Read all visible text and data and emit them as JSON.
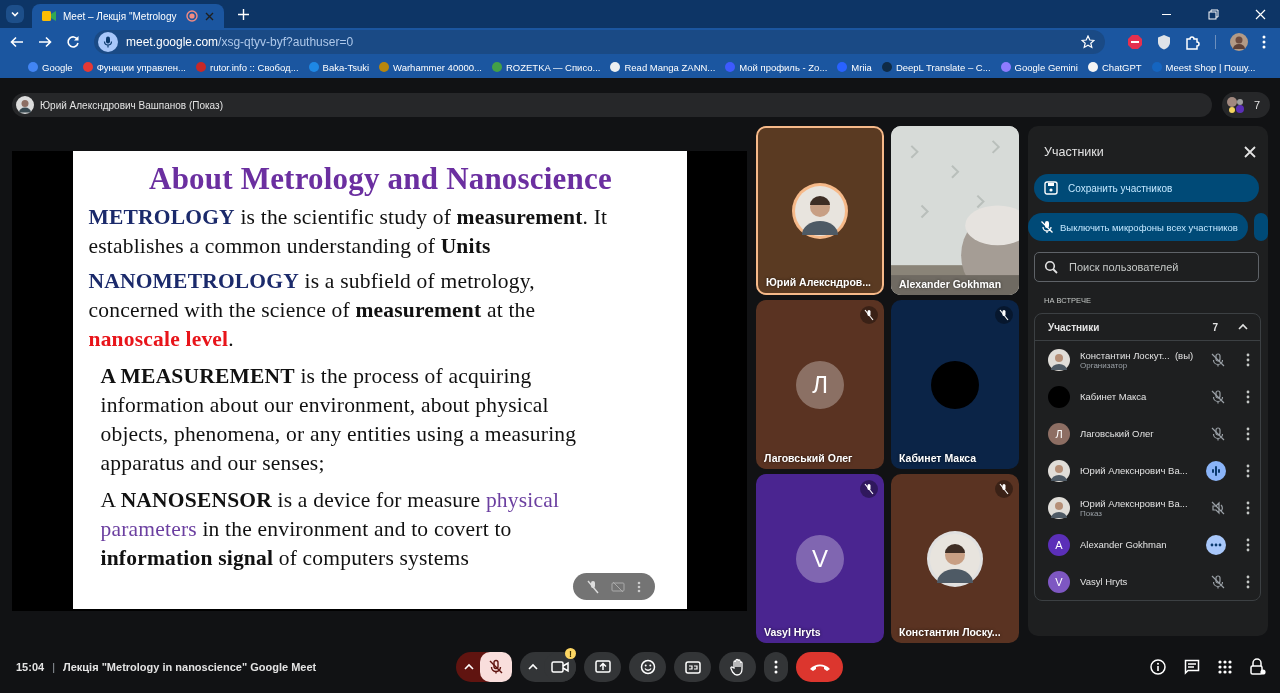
{
  "browser": {
    "tab": {
      "title": "Meet – Лекція \"Metrology",
      "recording": true
    },
    "url_host": "meet.google.com",
    "url_path": "/xsg-qtyv-byf?authuser=0",
    "bookmarks": [
      {
        "label": "Google",
        "color": "#4285f4"
      },
      {
        "label": "Функции управлен...",
        "color": "#e53935"
      },
      {
        "label": "rutor.info :: Свобод...",
        "color": "#c62828"
      },
      {
        "label": "Baka-Tsuki",
        "color": "#1e88e5"
      },
      {
        "label": "Warhammer 40000...",
        "color": "#b8860b"
      },
      {
        "label": "ROZETKA — Списо...",
        "color": "#43a047"
      },
      {
        "label": "Read Manga ZANN...",
        "color": "#eceff1"
      },
      {
        "label": "Мой профиль - Zo...",
        "color": "#3d5afe"
      },
      {
        "label": "Mriia",
        "color": "#2962ff"
      },
      {
        "label": "DeepL Translate – C...",
        "color": "#0f2b46"
      },
      {
        "label": "Google Gemini",
        "color": "#8e7cff"
      },
      {
        "label": "ChatGPT",
        "color": "#f5f5f5"
      },
      {
        "label": "Meest Shop | Пошу...",
        "color": "#1565c0"
      }
    ]
  },
  "presenter": {
    "label": "Юрий Алексндрович Вашпанов (Показ)",
    "count": "7"
  },
  "slide": {
    "title": "About Metrology and Nanoscience",
    "paragraphs": [
      {
        "lines": [
          [
            {
              "t": "METROLOGY",
              "kind": "term"
            },
            {
              "t": " is the scientific study of ",
              "kind": "plain"
            },
            {
              "t": "measurement",
              "kind": "bold"
            },
            {
              "t": ". It",
              "kind": "plain"
            }
          ],
          [
            {
              "t": "establishes a common understanding of ",
              "kind": "plain"
            },
            {
              "t": "Units",
              "kind": "bold"
            }
          ]
        ]
      },
      {
        "lines": [
          [
            {
              "t": "NANOMETROLOGY",
              "kind": "term"
            },
            {
              "t": " is a subfield of metrology,",
              "kind": "plain"
            }
          ],
          [
            {
              "t": "concerned with the science of ",
              "kind": "plain"
            },
            {
              "t": "measurement",
              "kind": "bold"
            },
            {
              "t": " at the",
              "kind": "plain"
            }
          ],
          [
            {
              "t": "nanoscale level",
              "kind": "alert"
            },
            {
              "t": ".",
              "kind": "plain"
            }
          ]
        ]
      },
      {
        "lines": [
          [
            {
              "t": "A MEASUREMENT",
              "kind": "bold"
            },
            {
              "t": " is the process of acquiring",
              "kind": "plain"
            }
          ],
          [
            {
              "t": "information about our environment, about physical",
              "kind": "plain"
            }
          ],
          [
            {
              "t": "objects, phenomena, or any entities using a measuring",
              "kind": "plain"
            }
          ],
          [
            {
              "t": "apparatus and our senses;",
              "kind": "plain"
            }
          ]
        ]
      },
      {
        "lines": [
          [
            {
              "t": "A ",
              "kind": "plain"
            },
            {
              "t": "NANOSENSOR",
              "kind": "bold"
            },
            {
              "t": " is a device for measure ",
              "kind": "plain"
            },
            {
              "t": "physical",
              "kind": "accent"
            }
          ],
          [
            {
              "t": "parameters",
              "kind": "accent"
            },
            {
              "t": " in the environment and to covert  to",
              "kind": "plain"
            }
          ],
          [
            {
              "t": "information signal",
              "kind": "bold"
            },
            {
              "t": " of computers systems",
              "kind": "plain"
            }
          ]
        ]
      }
    ]
  },
  "tiles": [
    {
      "name": "Юрий Алексндров...",
      "color": "#5a3a22",
      "muted": false,
      "active": true
    },
    {
      "name": "Alexander Gokhman",
      "kind": "video",
      "color": "#cfd3d0",
      "muted": false,
      "active": false
    },
    {
      "name": "Лаговський Олег",
      "kind": "letter",
      "letter": "Л",
      "color": "#5a3322",
      "muted": true,
      "active": false
    },
    {
      "name": "Кабинет Макса",
      "kind": "dark",
      "color": "#0b2447",
      "muted": true,
      "active": false
    },
    {
      "name": "Vasyl Hryts",
      "kind": "letter",
      "letter": "V",
      "color": "#4a2590",
      "muted": true,
      "active": false
    },
    {
      "name": "Константин Лоску...",
      "color": "#5a3322",
      "muted": true,
      "active": false
    }
  ],
  "panel": {
    "title": "Участники",
    "save": "Сохранить участников",
    "mute_all": "Выключить микрофоны всех участников",
    "search_placeholder": "Поиск пользователей",
    "section": "НА ВСТРЕЧЕ",
    "group": {
      "label": "Участники",
      "count": "7",
      "expanded": true
    },
    "people": [
      {
        "name": "Константин Лоскут...",
        "suffix": "(вы)",
        "role": "Организатор",
        "mic": {
          "kind": "muted"
        }
      },
      {
        "name": "Кабинет Макса",
        "avatar": {
          "kind": "dark"
        },
        "mic": {
          "kind": "muted"
        }
      },
      {
        "name": "Лаговський Олег",
        "avatar": {
          "kind": "letter",
          "letter": "Л",
          "color": "#8d6e63"
        },
        "mic": {
          "kind": "muted"
        }
      },
      {
        "name": "Юрий Алекснрович Ва...",
        "mic": {
          "kind": "speaking"
        }
      },
      {
        "name": "Юрий Алекснрович Ва...",
        "role": "Показ",
        "mic": {
          "kind": "presenting"
        }
      },
      {
        "name": "Alexander Gokhman",
        "avatar": {
          "kind": "letter",
          "letter": "A",
          "color": "#5b2fb8"
        },
        "mic": {
          "kind": "more"
        }
      },
      {
        "name": "Vasyl Hryts",
        "avatar": {
          "kind": "letter",
          "letter": "V",
          "color": "#7e57c2"
        },
        "mic": {
          "kind": "muted"
        }
      }
    ]
  },
  "footer": {
    "time": "15:04",
    "separator": "|",
    "meeting": "Лекція \"Metrology in nanoscience\" Google Meet",
    "mic_muted": true,
    "camera_warning": "!"
  }
}
